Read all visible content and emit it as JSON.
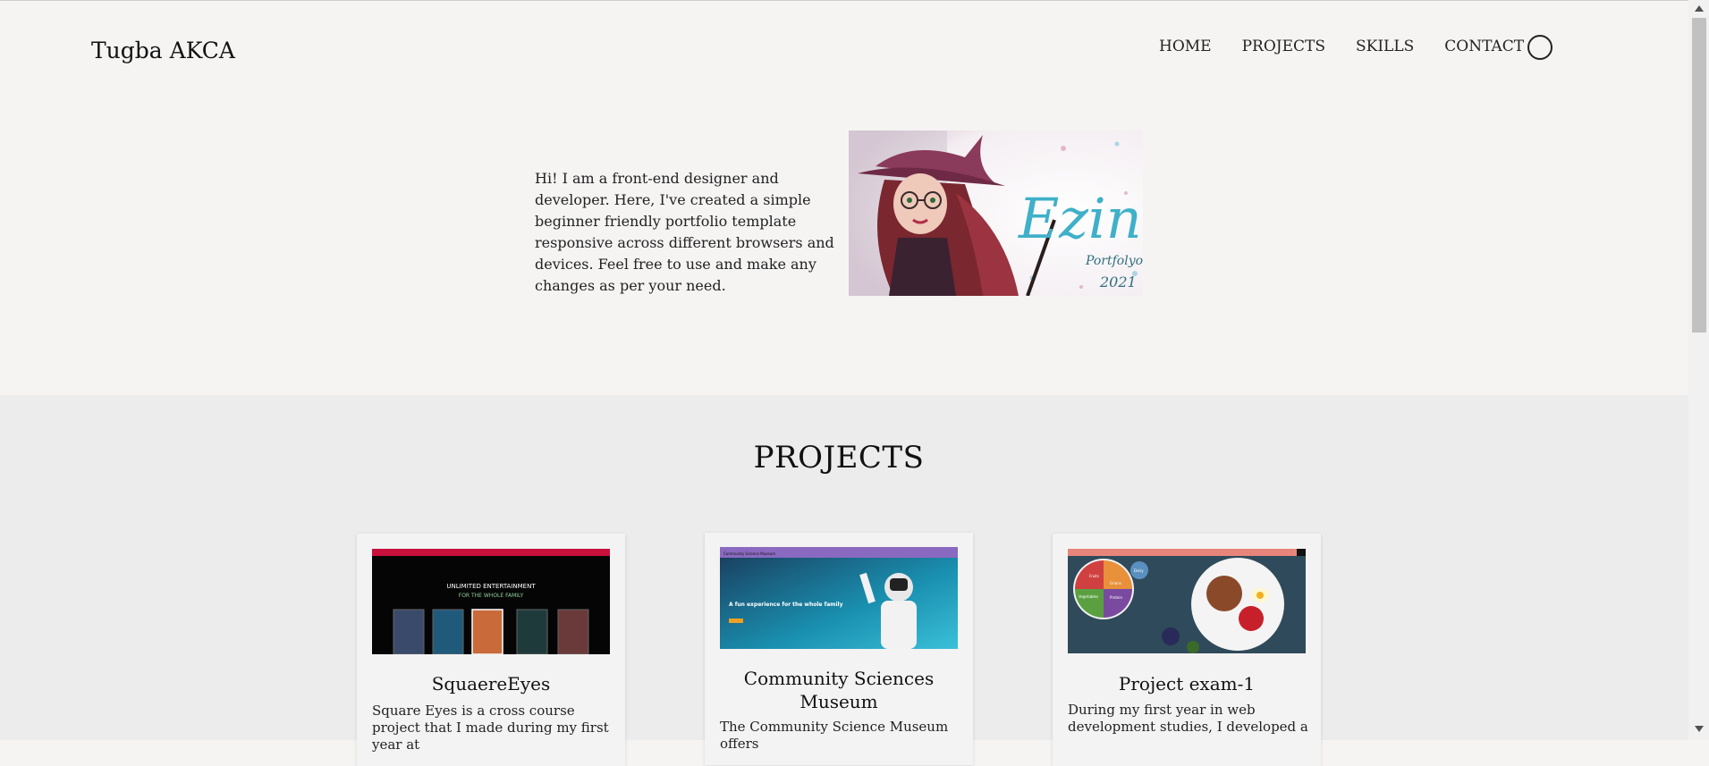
{
  "header": {
    "logo": "Tugba AKCA",
    "nav": [
      "HOME",
      "PROJECTS",
      "SKILLS",
      "CONTACT"
    ]
  },
  "hero": {
    "intro": "Hi! I am a front-end designer and developer. Here, I've created a simple beginner friendly portfolio template responsive across different browsers and devices. Feel free to use and make any changes as per your need.",
    "image": {
      "signature": "Ezin",
      "caption": "Portfolyo",
      "year": "2021"
    }
  },
  "projects": {
    "title": "PROJECTS",
    "cards": [
      {
        "title": "SquaereEyes",
        "description": "Square Eyes is a cross course project that I made during my first year at",
        "screenshot": {
          "headline": "UNLIMITED ENTERTAINMENT",
          "subheadline": "FOR THE WHOLE FAMILY"
        }
      },
      {
        "title": "Community Sciences Museum",
        "description": "The Community Science Museum offers",
        "screenshot": {
          "brand": "Community Science Museum",
          "headline": "A fun experience for the whole family"
        }
      },
      {
        "title": "Project exam-1",
        "description": "During my first year in web development studies, I developed a",
        "screenshot": {
          "labels": [
            "Fruits",
            "Grains",
            "Vegetables",
            "Protein",
            "Dairy"
          ]
        }
      }
    ]
  },
  "colors": {
    "page_bg": "#f5f4f3",
    "section_bg": "#ececec",
    "card_bg": "#f3f3f3",
    "text": "#111111"
  }
}
